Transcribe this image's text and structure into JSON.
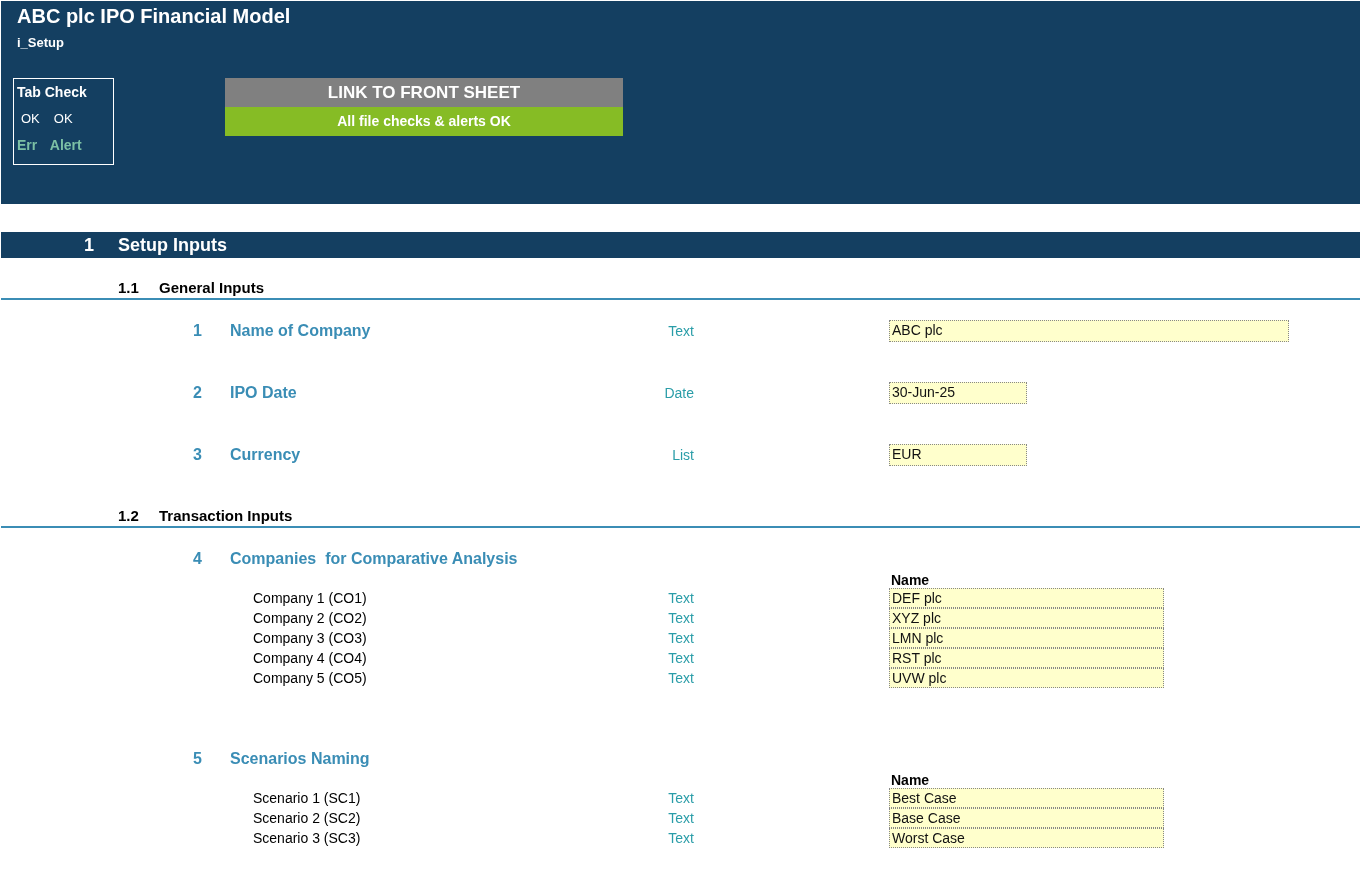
{
  "title": "ABC plc IPO Financial Model",
  "sheet": "i_Setup",
  "tab_check": {
    "title": "Tab Check",
    "checks": [
      {
        "value": "OK",
        "label": "Err"
      },
      {
        "value": "OK",
        "label": "Alert"
      }
    ]
  },
  "link_button": "LINK TO FRONT SHEET",
  "status": {
    "text": "All file checks & alerts OK",
    "ok": true
  },
  "section": {
    "number": "1",
    "title": "Setup Inputs",
    "subsections": [
      {
        "number": "1.1",
        "title": "General Inputs",
        "items": [
          {
            "kind": "long",
            "number": "1",
            "label": "Name of Company",
            "type_label": "Text",
            "value": "ABC plc"
          },
          {
            "kind": "short",
            "number": "2",
            "label": "IPO Date",
            "type_label": "Date",
            "value": "30-Jun-25"
          },
          {
            "kind": "short",
            "number": "3",
            "label": "Currency",
            "type_label": "List",
            "value": "EUR"
          }
        ]
      },
      {
        "number": "1.2",
        "title": "Transaction Inputs",
        "items": [
          {
            "kind": "table",
            "number": "4",
            "label": "Companies  for Comparative Analysis",
            "column_heading": "Name",
            "rows": [
              {
                "label": "Company 1 (CO1)",
                "type_label": "Text",
                "value": "DEF plc"
              },
              {
                "label": "Company 2 (CO2)",
                "type_label": "Text",
                "value": "XYZ plc"
              },
              {
                "label": "Company 3 (CO3)",
                "type_label": "Text",
                "value": "LMN plc"
              },
              {
                "label": "Company 4 (CO4)",
                "type_label": "Text",
                "value": "RST plc"
              },
              {
                "label": "Company 5 (CO5)",
                "type_label": "Text",
                "value": "UVW plc"
              }
            ]
          },
          {
            "kind": "table",
            "number": "5",
            "label": "Scenarios Naming",
            "column_heading": "Name",
            "rows": [
              {
                "label": "Scenario 1 (SC1)",
                "type_label": "Text",
                "value": "Best Case"
              },
              {
                "label": "Scenario 2 (SC2)",
                "type_label": "Text",
                "value": "Base Case"
              },
              {
                "label": "Scenario 3 (SC3)",
                "type_label": "Text",
                "value": "Worst Case"
              }
            ]
          }
        ]
      }
    ]
  }
}
